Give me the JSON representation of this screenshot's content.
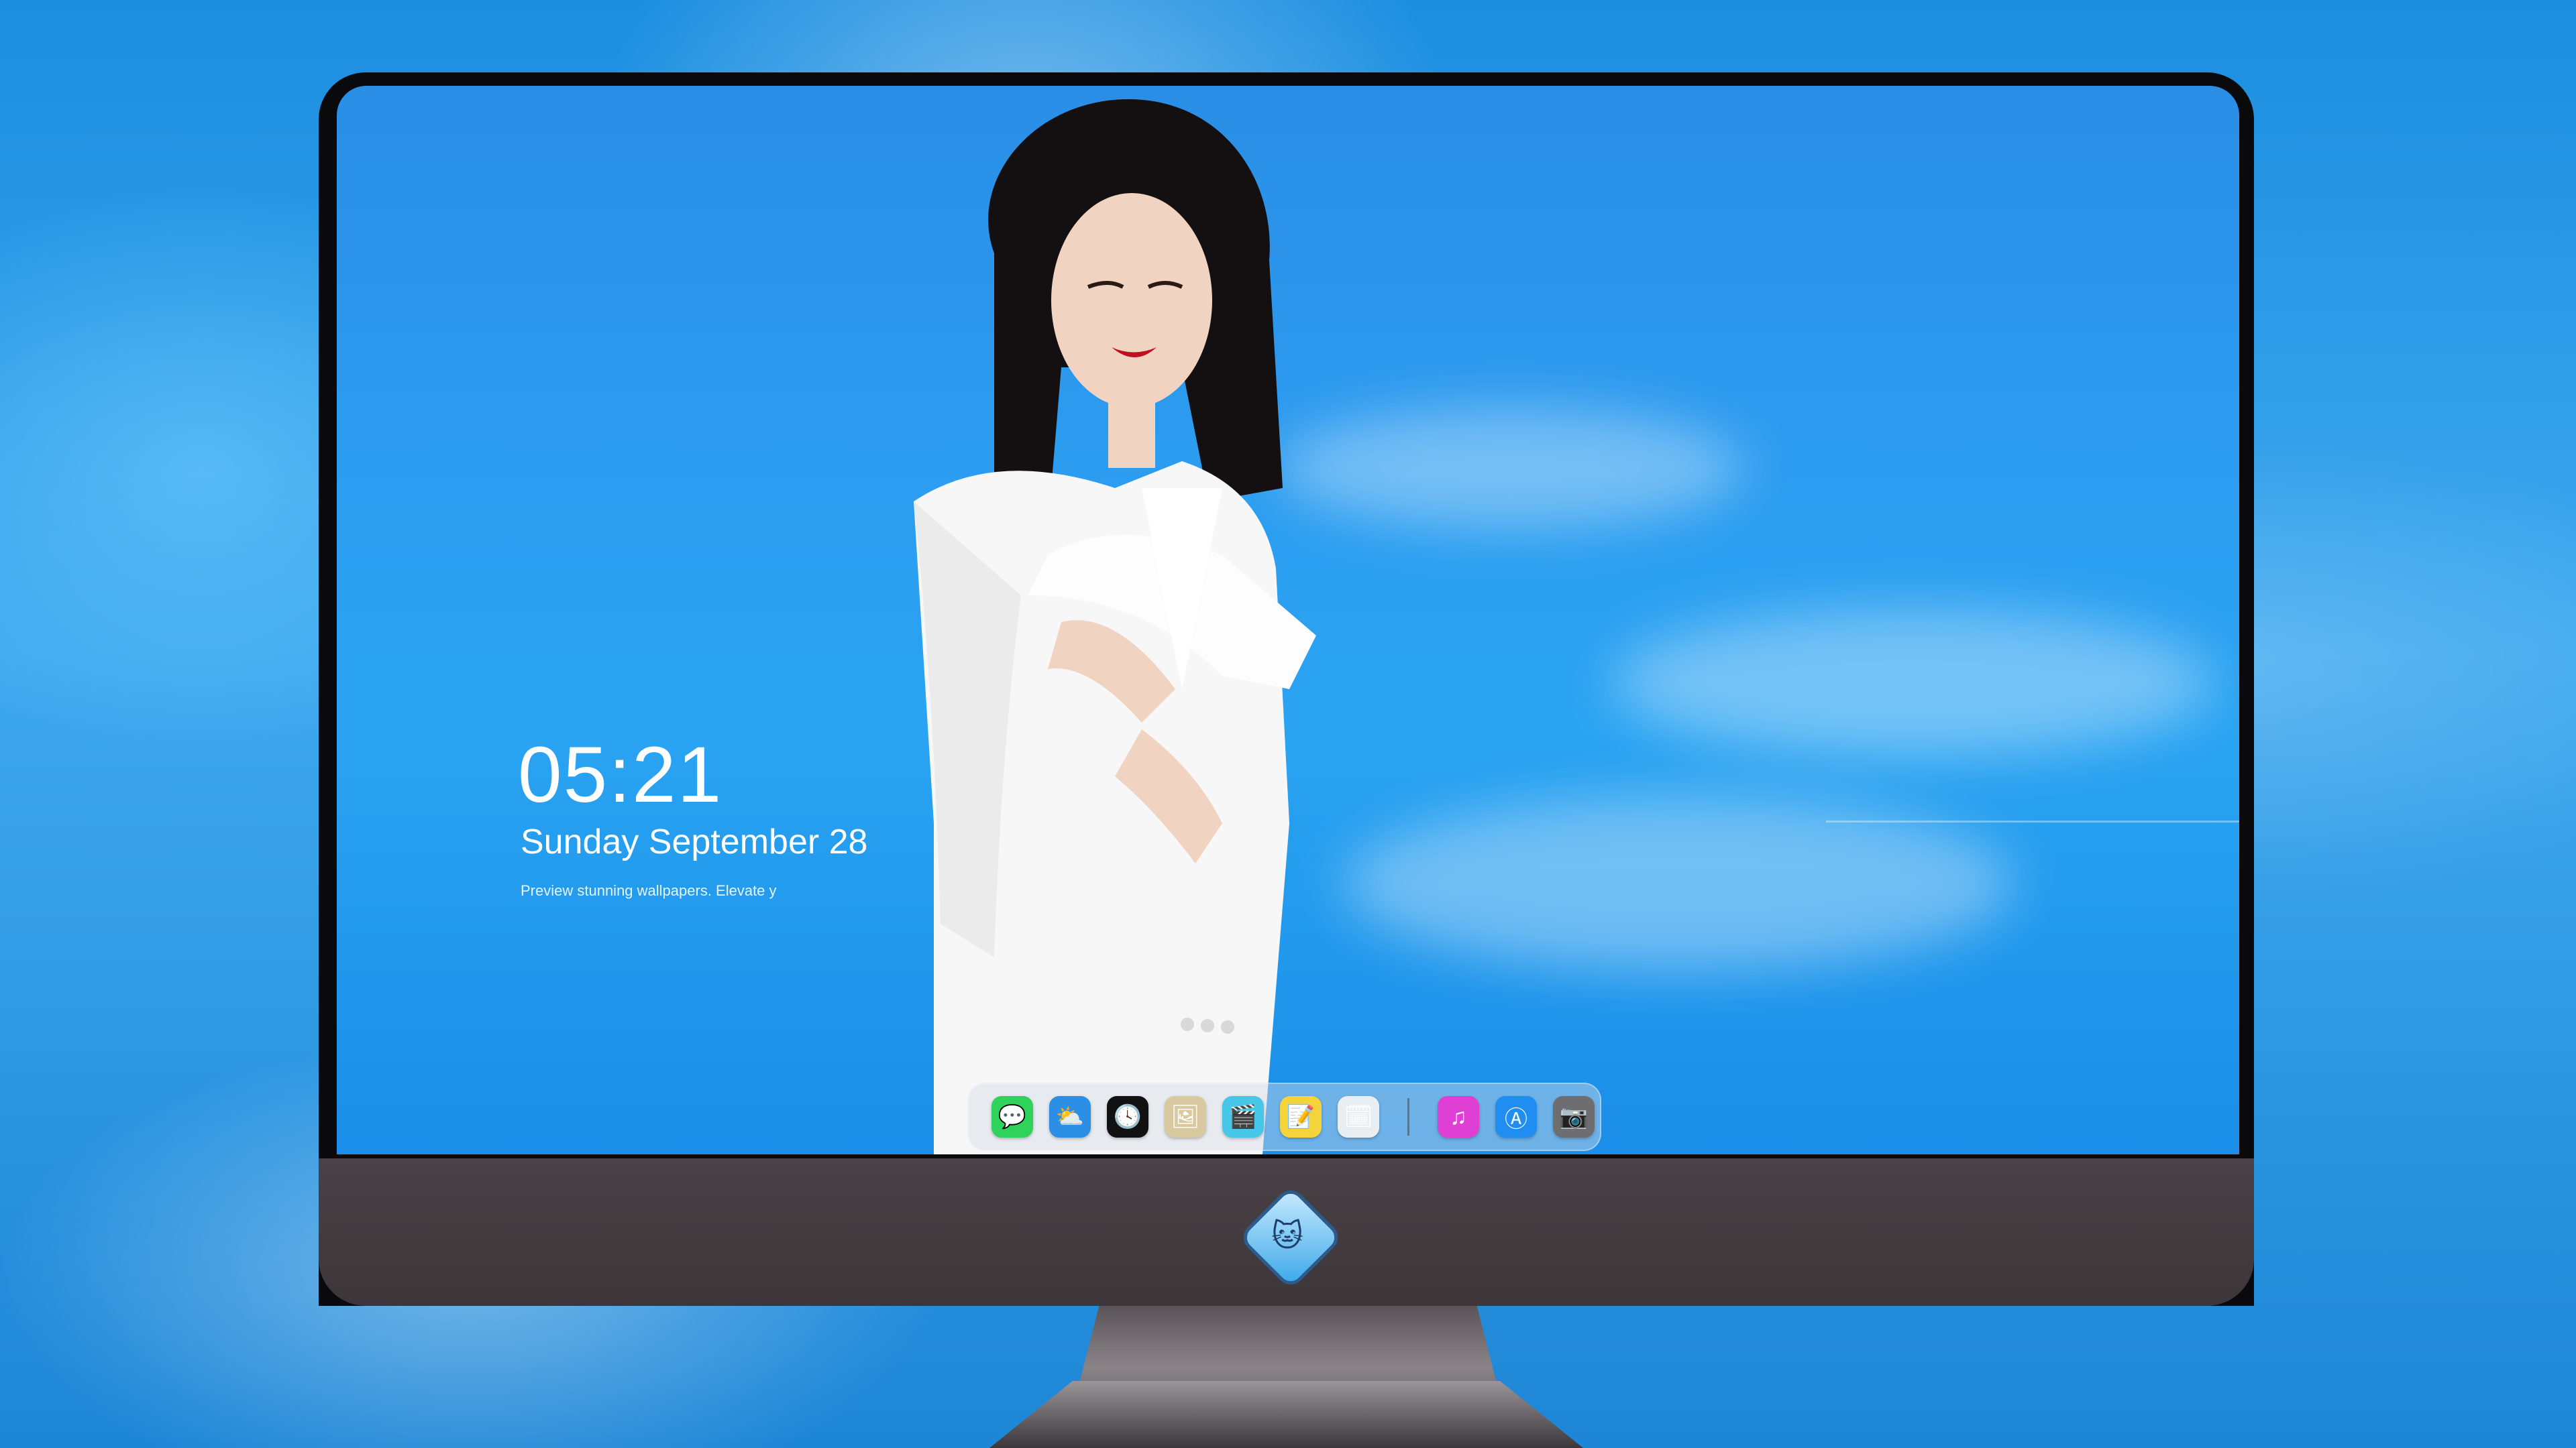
{
  "lockscreen": {
    "time": "05:21",
    "date": "Sunday September 28",
    "subtitle": "Preview stunning wallpapers. Elevate y"
  },
  "dock": {
    "apps": [
      {
        "name": "Messages",
        "icon": "messages-icon",
        "color": "#2fd25a",
        "glyph": "💬"
      },
      {
        "name": "Weather",
        "icon": "weather-icon",
        "color": "#2b8fe6",
        "glyph": "⛅"
      },
      {
        "name": "Clock",
        "icon": "clock-icon",
        "color": "#111111",
        "glyph": "🕓"
      },
      {
        "name": "Preview",
        "icon": "preview-icon",
        "color": "#d9c9a0",
        "glyph": "🖼"
      },
      {
        "name": "Clips",
        "icon": "clips-icon",
        "color": "#47c7e8",
        "glyph": "🎬"
      },
      {
        "name": "Notes",
        "icon": "notes-icon",
        "color": "#f5d33b",
        "glyph": "📝"
      },
      {
        "name": "Photo Booth",
        "icon": "photo-booth-icon",
        "color": "#e9eef2",
        "glyph": "🗓"
      },
      {
        "name": "iTunes",
        "icon": "itunes-icon",
        "color": "#e03fd6",
        "glyph": "♫"
      },
      {
        "name": "App Store",
        "icon": "app-store-icon",
        "color": "#1f8ef0",
        "glyph": "Ⓐ"
      },
      {
        "name": "Camera",
        "icon": "camera-icon",
        "color": "#6e6e70",
        "glyph": "📷"
      }
    ]
  }
}
